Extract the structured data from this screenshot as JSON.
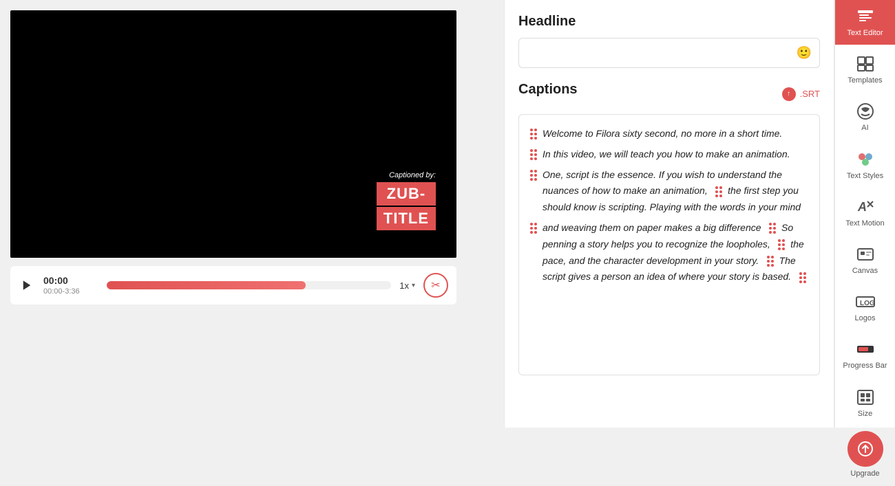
{
  "video": {
    "caption_label": "Captioned by:",
    "caption_line1": "ZUB-",
    "caption_line2": "TITLE",
    "time_current": "00:00",
    "time_total": "00:00-3:36",
    "speed": "1x",
    "progress_percent": 70
  },
  "center": {
    "headline_label": "Headline",
    "headline_placeholder": "",
    "captions_label": "Captions",
    "srt_label": ".SRT",
    "captions": [
      {
        "text": "Welcome to Filora sixty second, no more in a short time."
      },
      {
        "text": "In this video, we will teach you how to make an animation."
      },
      {
        "text": "One, script is the essence. If you wish to understand the nuances of how to make an animation,",
        "has_end_dots": true,
        "end_text": "the first step you should know is scripting. Playing with the words in your mind"
      },
      {
        "text": "and weaving them on paper makes a big difference",
        "has_end_dots": true,
        "end_text": "So penning a story helps you to recognize the loopholes,",
        "has_end2": true,
        "end2_text": "the pace, and the character development in your story.",
        "has_end3": true,
        "end3_text": "The script gives a person an idea of where your story is based.",
        "has_end4": true
      }
    ]
  },
  "sidebar": {
    "items": [
      {
        "id": "text-editor",
        "label": "Text Editor",
        "active": true
      },
      {
        "id": "templates",
        "label": "Templates",
        "active": false
      },
      {
        "id": "ai",
        "label": "AI",
        "active": false
      },
      {
        "id": "text-styles",
        "label": "Text Styles",
        "active": false
      },
      {
        "id": "text-motion",
        "label": "Text Motion",
        "active": false
      },
      {
        "id": "canvas",
        "label": "Canvas",
        "active": false
      },
      {
        "id": "logos",
        "label": "Logos",
        "active": false
      },
      {
        "id": "progress-bar",
        "label": "Progress Bar",
        "active": false
      },
      {
        "id": "size",
        "label": "Size",
        "active": false
      }
    ],
    "upgrade_label": "Upgrade"
  }
}
